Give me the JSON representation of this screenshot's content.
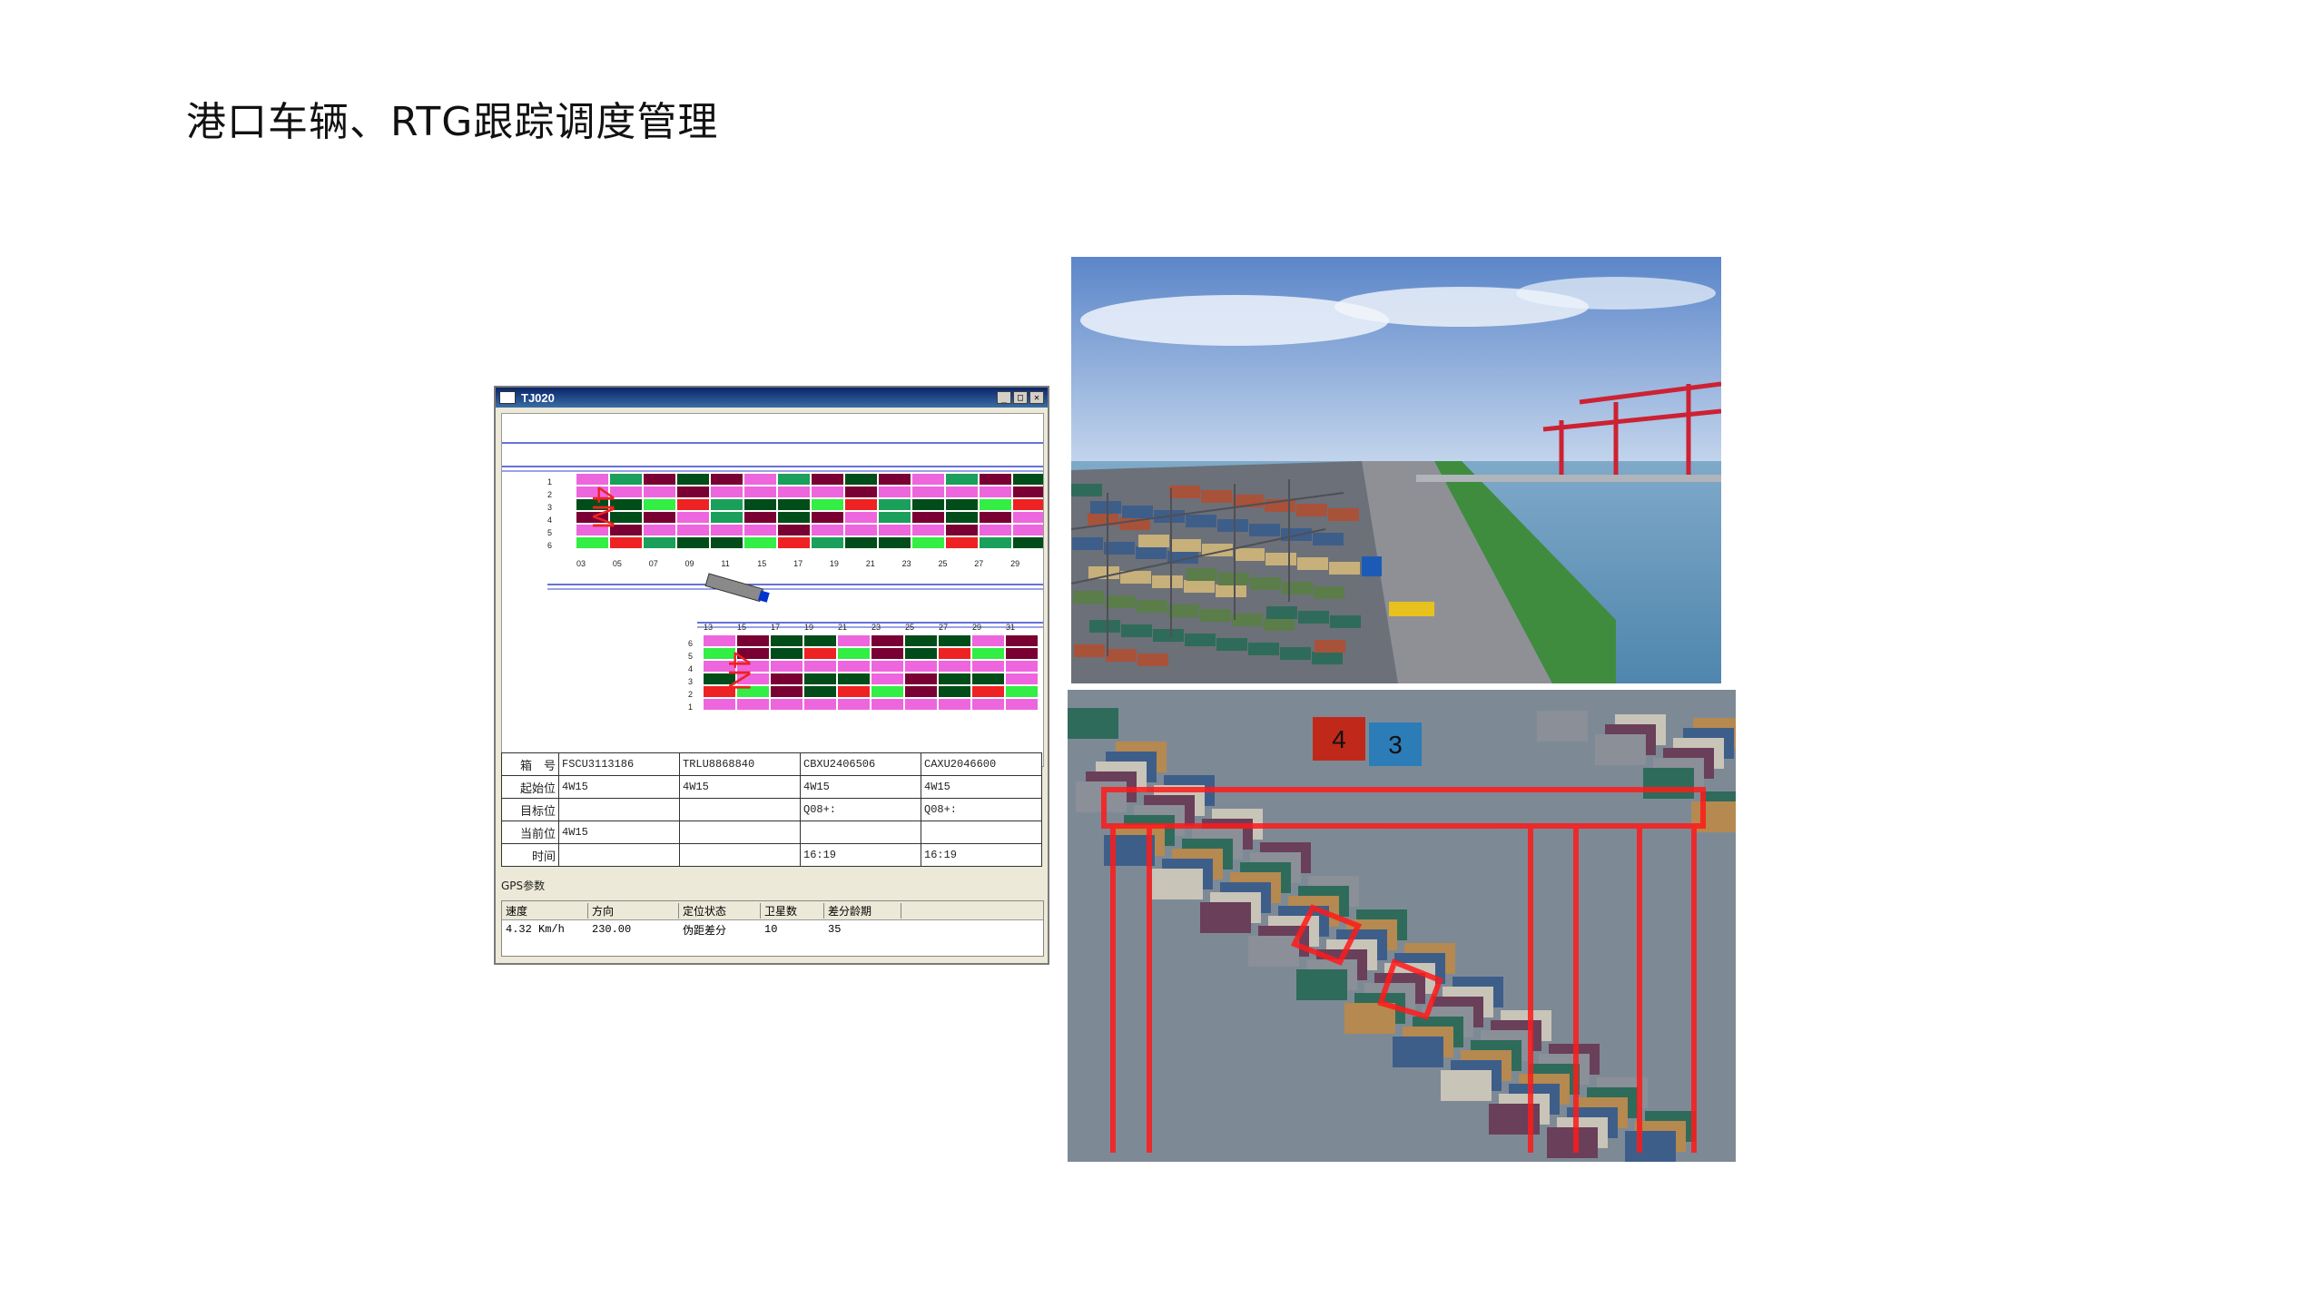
{
  "slide": {
    "title": "港口车辆、RTG跟踪调度管理"
  },
  "window": {
    "title": "TJ020",
    "controls": {
      "minimize": "_",
      "maximize": "□",
      "close": "✕"
    },
    "block_top": {
      "label": "4M",
      "row_labels": [
        "1",
        "2",
        "3",
        "4",
        "5",
        "6"
      ],
      "bay_labels": [
        "03",
        "05",
        "07",
        "09",
        "11",
        "15",
        "17",
        "19",
        "21",
        "23",
        "25",
        "27",
        "29"
      ]
    },
    "block_bottom": {
      "label": "4N",
      "row_labels": [
        "6",
        "5",
        "4",
        "3",
        "2",
        "1"
      ],
      "bay_labels": [
        "13",
        "15",
        "17",
        "19",
        "21",
        "23",
        "25",
        "27",
        "29",
        "31"
      ]
    },
    "info_table": {
      "labels": [
        "箱　号",
        "起始位",
        "目标位",
        "当前位",
        "时间"
      ],
      "columns": [
        [
          "FSCU3113186",
          "4W15",
          "",
          "4W15",
          ""
        ],
        [
          "TRLU8868840",
          "4W15",
          "",
          "",
          ""
        ],
        [
          "CBXU2406506",
          "4W15",
          "Q08+:",
          "",
          "16:19"
        ],
        [
          "CAXU2046600",
          "4W15",
          "Q08+:",
          "",
          "16:19"
        ]
      ]
    },
    "gps": {
      "label": "GPS参数",
      "headers": [
        "速度",
        "方向",
        "定位状态",
        "卫星数",
        "差分龄期"
      ],
      "values": [
        "4.32 Km/h",
        "230.00",
        "伪距差分",
        "10",
        "35"
      ]
    }
  },
  "views": {
    "top": {
      "name": "3D port overview"
    },
    "bottom": {
      "name": "RTG tracking",
      "markers": [
        "4",
        "3"
      ]
    }
  },
  "colors": {
    "magenta": "#ee66dd",
    "dark_green": "#004d1a",
    "green": "#1aa05a",
    "bright_green": "#33ee44",
    "red": "#ee2222",
    "maroon": "#7a0033",
    "block_label": "#ee2222"
  }
}
